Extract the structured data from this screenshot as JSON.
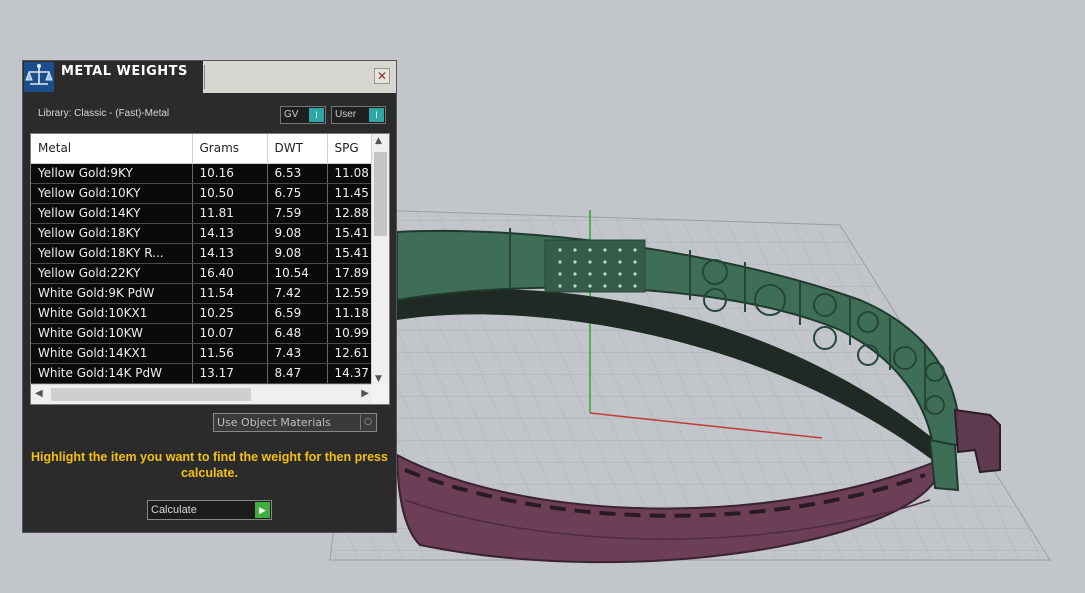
{
  "panel": {
    "title": "METAL WEIGHTS",
    "close_glyph": "✕",
    "library_label": "Library: Classic - (Fast)-Metal",
    "toggles": [
      {
        "label": "GV",
        "state_glyph": "I"
      },
      {
        "label": "User",
        "state_glyph": "I"
      }
    ],
    "table": {
      "columns": [
        "Metal",
        "Grams",
        "DWT",
        "SPG"
      ],
      "rows": [
        [
          "Yellow Gold:9KY",
          "10.16",
          "6.53",
          "11.08"
        ],
        [
          "Yellow Gold:10KY",
          "10.50",
          "6.75",
          "11.45"
        ],
        [
          "Yellow Gold:14KY",
          "11.81",
          "7.59",
          "12.88"
        ],
        [
          "Yellow Gold:18KY",
          "14.13",
          "9.08",
          "15.41"
        ],
        [
          "Yellow Gold:18KY R...",
          "14.13",
          "9.08",
          "15.41"
        ],
        [
          "Yellow Gold:22KY",
          "16.40",
          "10.54",
          "17.89"
        ],
        [
          "White Gold:9K PdW",
          "11.54",
          "7.42",
          "12.59"
        ],
        [
          "White Gold:10KX1",
          "10.25",
          "6.59",
          "11.18"
        ],
        [
          "White Gold:10KW",
          "10.07",
          "6.48",
          "10.99"
        ],
        [
          "White Gold:14KX1",
          "11.56",
          "7.43",
          "12.61"
        ],
        [
          "White Gold:14K PdW",
          "13.17",
          "8.47",
          "14.37"
        ]
      ]
    },
    "materials_dropdown": {
      "value": "Use Object Materials",
      "icon": "dropdown-icon"
    },
    "instructions": "Highlight the item you want to find the weight for then press calculate.",
    "calculate_button": {
      "label": "Calculate",
      "icon": "play-icon"
    }
  },
  "colors": {
    "panel_bg": "#2b2b2b",
    "accent_teal": "#2fa6a6",
    "instruction_yellow": "#f2c10f",
    "go_green": "#3fae3f",
    "ring_green": "#3f6e58",
    "ring_inside_purple": "#6c3f57",
    "viewport_bg": "#c2c5ca"
  }
}
